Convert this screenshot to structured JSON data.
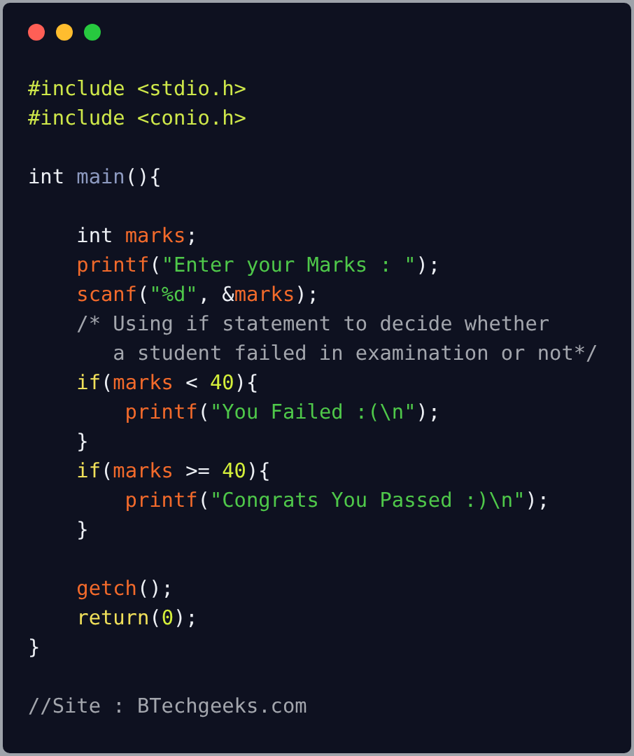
{
  "window": {
    "controls": [
      {
        "color": "#ff5f56"
      },
      {
        "color": "#ffbd2e"
      },
      {
        "color": "#27c93f"
      }
    ]
  },
  "code": {
    "lines": [
      {
        "kind": "code",
        "tokens": [
          {
            "kind": "directive",
            "text": "#include <stdio.h>"
          }
        ]
      },
      {
        "kind": "code",
        "tokens": [
          {
            "kind": "directive",
            "text": "#include <conio.h>"
          }
        ]
      },
      {
        "kind": "blank"
      },
      {
        "kind": "code",
        "tokens": [
          {
            "kind": "keyword",
            "text": "int "
          },
          {
            "kind": "entry",
            "text": "main"
          },
          {
            "kind": "plain",
            "text": "(){"
          }
        ]
      },
      {
        "kind": "blank"
      },
      {
        "kind": "code",
        "tokens": [
          {
            "kind": "keyword",
            "text": "    int "
          },
          {
            "kind": "name",
            "text": "marks"
          },
          {
            "kind": "plain",
            "text": ";"
          }
        ]
      },
      {
        "kind": "code",
        "tokens": [
          {
            "kind": "name",
            "text": "    printf"
          },
          {
            "kind": "plain",
            "text": "("
          },
          {
            "kind": "string",
            "text": "\"Enter your Marks : \""
          },
          {
            "kind": "plain",
            "text": ");"
          }
        ]
      },
      {
        "kind": "code",
        "tokens": [
          {
            "kind": "name",
            "text": "    scanf"
          },
          {
            "kind": "plain",
            "text": "("
          },
          {
            "kind": "string",
            "text": "\"%d\""
          },
          {
            "kind": "plain",
            "text": ", &"
          },
          {
            "kind": "name",
            "text": "marks"
          },
          {
            "kind": "plain",
            "text": ");"
          }
        ]
      },
      {
        "kind": "code",
        "tokens": [
          {
            "kind": "comment",
            "text": "    /* Using if statement to decide whether"
          }
        ]
      },
      {
        "kind": "code",
        "tokens": [
          {
            "kind": "comment",
            "text": "       a student failed in examination or not*/"
          }
        ]
      },
      {
        "kind": "code",
        "tokens": [
          {
            "kind": "control",
            "text": "    if"
          },
          {
            "kind": "plain",
            "text": "("
          },
          {
            "kind": "name",
            "text": "marks"
          },
          {
            "kind": "plain",
            "text": " < "
          },
          {
            "kind": "number",
            "text": "40"
          },
          {
            "kind": "plain",
            "text": "){"
          }
        ]
      },
      {
        "kind": "code",
        "tokens": [
          {
            "kind": "name",
            "text": "        printf"
          },
          {
            "kind": "plain",
            "text": "("
          },
          {
            "kind": "string",
            "text": "\"You Failed :(\\n\""
          },
          {
            "kind": "plain",
            "text": ");"
          }
        ]
      },
      {
        "kind": "code",
        "tokens": [
          {
            "kind": "plain",
            "text": "    }"
          }
        ]
      },
      {
        "kind": "code",
        "tokens": [
          {
            "kind": "control",
            "text": "    if"
          },
          {
            "kind": "plain",
            "text": "("
          },
          {
            "kind": "name",
            "text": "marks"
          },
          {
            "kind": "plain",
            "text": " >= "
          },
          {
            "kind": "number",
            "text": "40"
          },
          {
            "kind": "plain",
            "text": "){"
          }
        ]
      },
      {
        "kind": "code",
        "tokens": [
          {
            "kind": "name",
            "text": "        printf"
          },
          {
            "kind": "plain",
            "text": "("
          },
          {
            "kind": "string",
            "text": "\"Congrats You Passed :)\\n\""
          },
          {
            "kind": "plain",
            "text": ");"
          }
        ]
      },
      {
        "kind": "code",
        "tokens": [
          {
            "kind": "plain",
            "text": "    }"
          }
        ]
      },
      {
        "kind": "blank"
      },
      {
        "kind": "code",
        "tokens": [
          {
            "kind": "name",
            "text": "    getch"
          },
          {
            "kind": "plain",
            "text": "();"
          }
        ]
      },
      {
        "kind": "code",
        "tokens": [
          {
            "kind": "control",
            "text": "    return"
          },
          {
            "kind": "plain",
            "text": "("
          },
          {
            "kind": "number",
            "text": "0"
          },
          {
            "kind": "plain",
            "text": ");"
          }
        ]
      },
      {
        "kind": "code",
        "tokens": [
          {
            "kind": "plain",
            "text": "}"
          }
        ]
      },
      {
        "kind": "blank"
      },
      {
        "kind": "code",
        "tokens": [
          {
            "kind": "comment",
            "text": "//Site : BTechgeeks.com"
          }
        ]
      }
    ]
  }
}
